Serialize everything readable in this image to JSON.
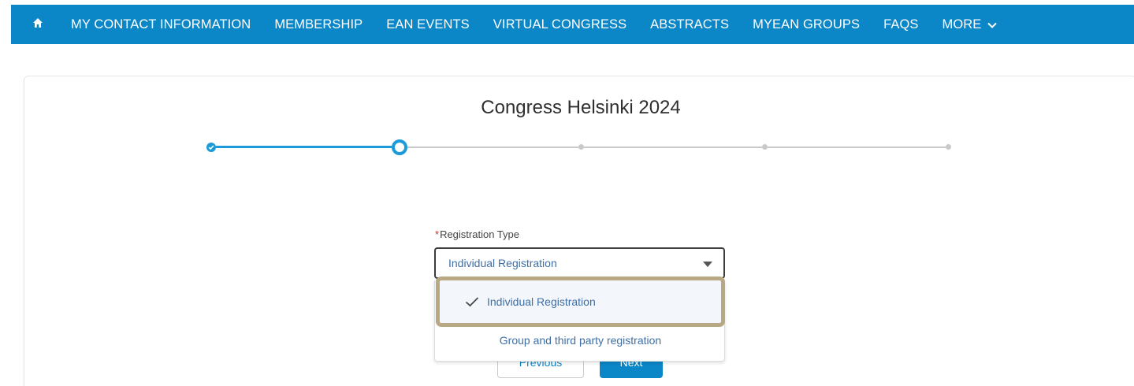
{
  "nav": {
    "items": [
      {
        "label": "MY CONTACT INFORMATION"
      },
      {
        "label": "MEMBERSHIP"
      },
      {
        "label": "EAN EVENTS"
      },
      {
        "label": "VIRTUAL CONGRESS"
      },
      {
        "label": "ABSTRACTS"
      },
      {
        "label": "MYEAN GROUPS"
      },
      {
        "label": "FAQS"
      }
    ],
    "more_label": "MORE",
    "home_icon": "home-icon",
    "bar_color": "#0b86c7"
  },
  "page": {
    "title": "Congress Helsinki 2024"
  },
  "progress": {
    "current_step": 2,
    "total_steps": 5,
    "accent_color": "#1b9bd7"
  },
  "form": {
    "registration_type": {
      "label": "Registration Type",
      "required_marker": "*",
      "value": "Individual Registration",
      "options": [
        {
          "label": "Individual Registration",
          "selected": true
        },
        {
          "label": "Group and third party registration",
          "selected": false
        }
      ]
    },
    "buttons": {
      "previous_label": "Previous",
      "next_label": "Next"
    }
  },
  "annotation": {
    "highlight_color": "#b8a884"
  }
}
